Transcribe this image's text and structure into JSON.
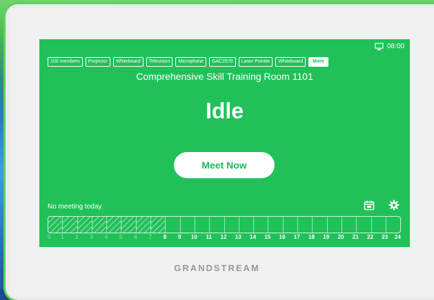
{
  "status": {
    "time": "08:00",
    "icon": "screen-cast-icon"
  },
  "tags": [
    "100 members",
    "Projector",
    "Whiteboard",
    "Television",
    "Microphone",
    "GAC2570",
    "Laser Pointer",
    "Whiteboard"
  ],
  "more_label": "More",
  "room_name": "Comprehensive Skill Training Room 1101",
  "room_state": "Idle",
  "meet_button_label": "Meet Now",
  "schedule_text": "No meeting today.",
  "controls": {
    "calendar_icon": "calendar-icon",
    "settings_icon": "gear-icon"
  },
  "timeline": {
    "hours": [
      "0",
      "1",
      "2",
      "3",
      "4",
      "5",
      "6",
      "7",
      "8",
      "9",
      "10",
      "11",
      "12",
      "13",
      "14",
      "15",
      "16",
      "17",
      "18",
      "19",
      "20",
      "21",
      "22",
      "23",
      "24"
    ],
    "elapsed_slots": 8,
    "total_slots": 24
  },
  "brand": "GRANDSTREAM",
  "colors": {
    "screen": "#21c15a",
    "accent": "#ffffff"
  }
}
